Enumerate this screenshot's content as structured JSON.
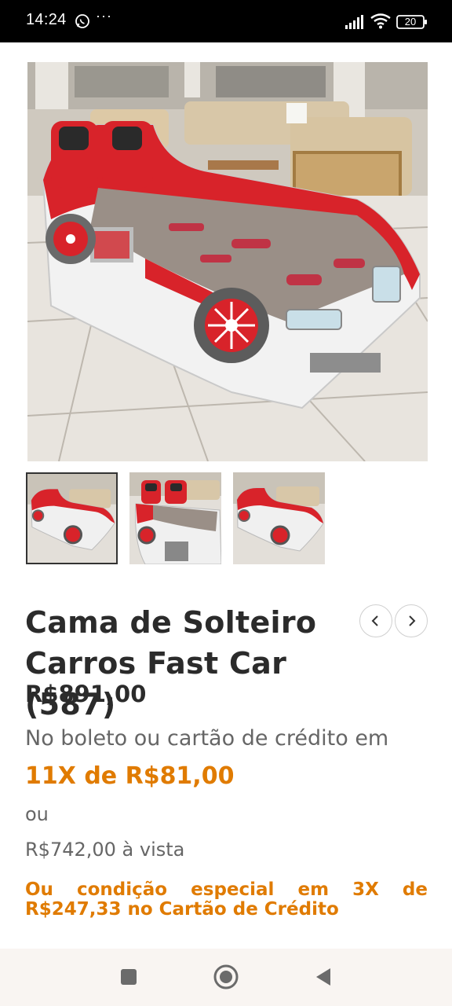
{
  "status_bar": {
    "time": "14:24",
    "notification_icons": [
      "whatsapp-icon",
      "more-dots-icon"
    ],
    "dots": "···",
    "battery": "20"
  },
  "product": {
    "image_subject": "red and white race car bed in furniture showroom",
    "thumbnail_count": 3,
    "title_line1": "Cama de Solteiro",
    "title_line2": "Carros Fast Car (587)",
    "price": "R$891,00",
    "payment_note": "No boleto ou cartão de crédito em",
    "installment": "11X de R$81,00",
    "or_text": "ou",
    "cash_price": "R$742,00 à vista",
    "special_line1": "Ou condição especial em 3X de",
    "special_line2": "R$247,33 no Cartão de Crédito"
  },
  "colors": {
    "accent": "#e07b00",
    "text_dark": "#2b2b2b",
    "text_muted": "#666666",
    "car_red": "#d8232a",
    "navbar_bg": "#f9f5f2"
  },
  "nav_bar": {
    "buttons": [
      "recents-button",
      "home-button",
      "back-button"
    ]
  }
}
